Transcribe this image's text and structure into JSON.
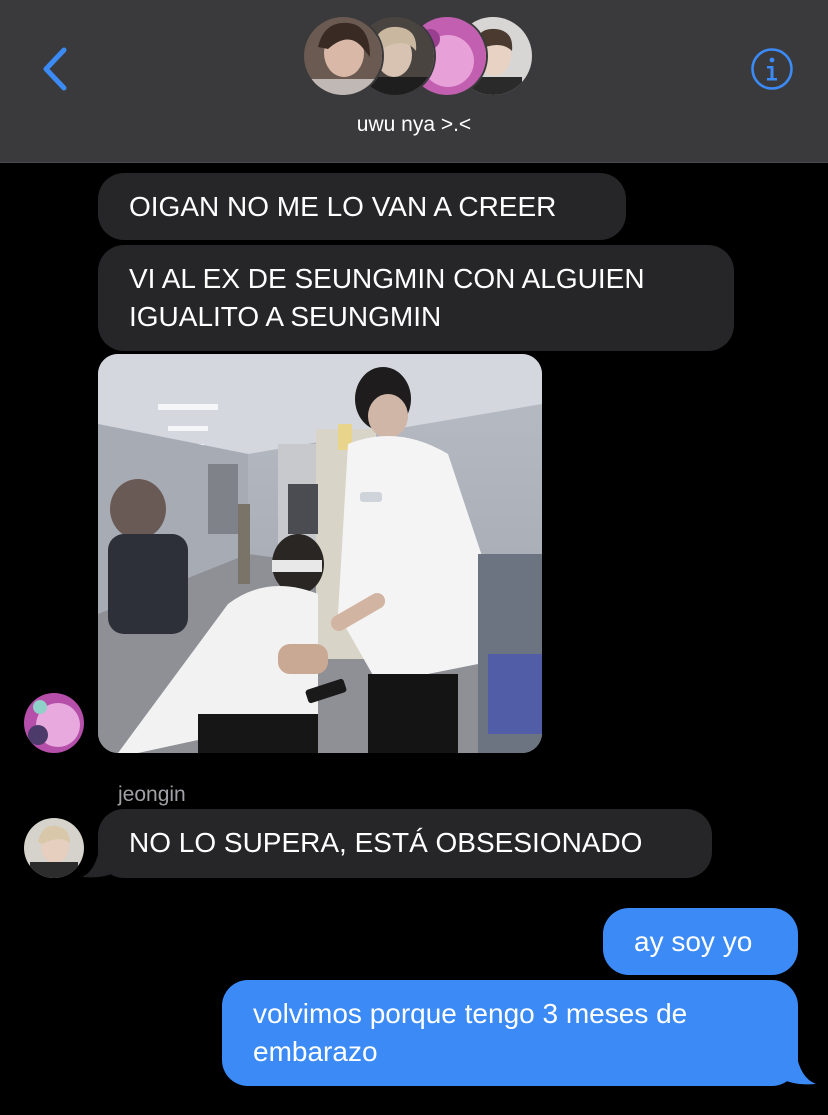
{
  "header": {
    "group_name": "uwu nya >.<"
  },
  "messages": [
    {
      "text": "OIGAN NO ME LO VAN A CREER"
    },
    {
      "line1": "VI AL EX DE SEUNGMIN CON ALGUIEN",
      "line2": "IGUALITO A SEUNGMIN"
    },
    {
      "sender": "jeongin",
      "text": "NO LO SUPERA, ESTÁ OBSESIONADO"
    },
    {
      "text": "ay soy yo"
    },
    {
      "line1": "volvimos porque tengo 3 meses de",
      "line2": "embarazo"
    }
  ],
  "colors": {
    "header_bg": "#3a3a3c",
    "accent": "#3b8af5",
    "incoming_bubble": "#262628",
    "outgoing_bubble": "#3b8af5"
  },
  "icons": [
    "back-chevron-icon",
    "info-icon"
  ]
}
